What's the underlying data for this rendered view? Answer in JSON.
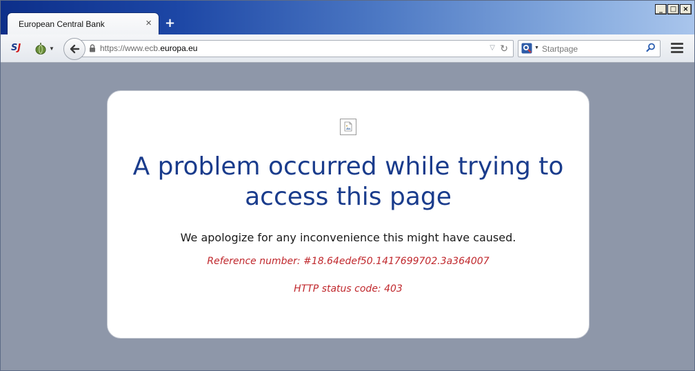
{
  "window": {
    "controls": {
      "minimize": "_",
      "maximize": "□",
      "close": "×"
    }
  },
  "tabs": [
    {
      "title": "European Central Bank",
      "close_glyph": "×"
    }
  ],
  "new_tab_glyph": "+",
  "toolbar": {
    "url_prefix": "https://www.ecb.",
    "url_domain": "europa.eu",
    "search_placeholder": "Startpage"
  },
  "page": {
    "heading": "A problem occurred while trying to access this page",
    "apology": "We apologize for any inconvenience this might have caused.",
    "reference": "Reference number: #18.64edef50.1417699702.3a364007",
    "status": "HTTP status code: 403"
  },
  "colors": {
    "heading": "#1a3c8c",
    "error_text": "#c0282d",
    "page_background": "#8e97a9"
  },
  "icons": {
    "toolbar": [
      "sj-extension-icon",
      "onion-extension-icon",
      "back-arrow-icon",
      "lock-icon",
      "dropdown-arrow-icon",
      "reload-icon",
      "search-engine-icon",
      "search-icon",
      "hamburger-menu-icon"
    ],
    "content": [
      "broken-image-icon"
    ]
  }
}
